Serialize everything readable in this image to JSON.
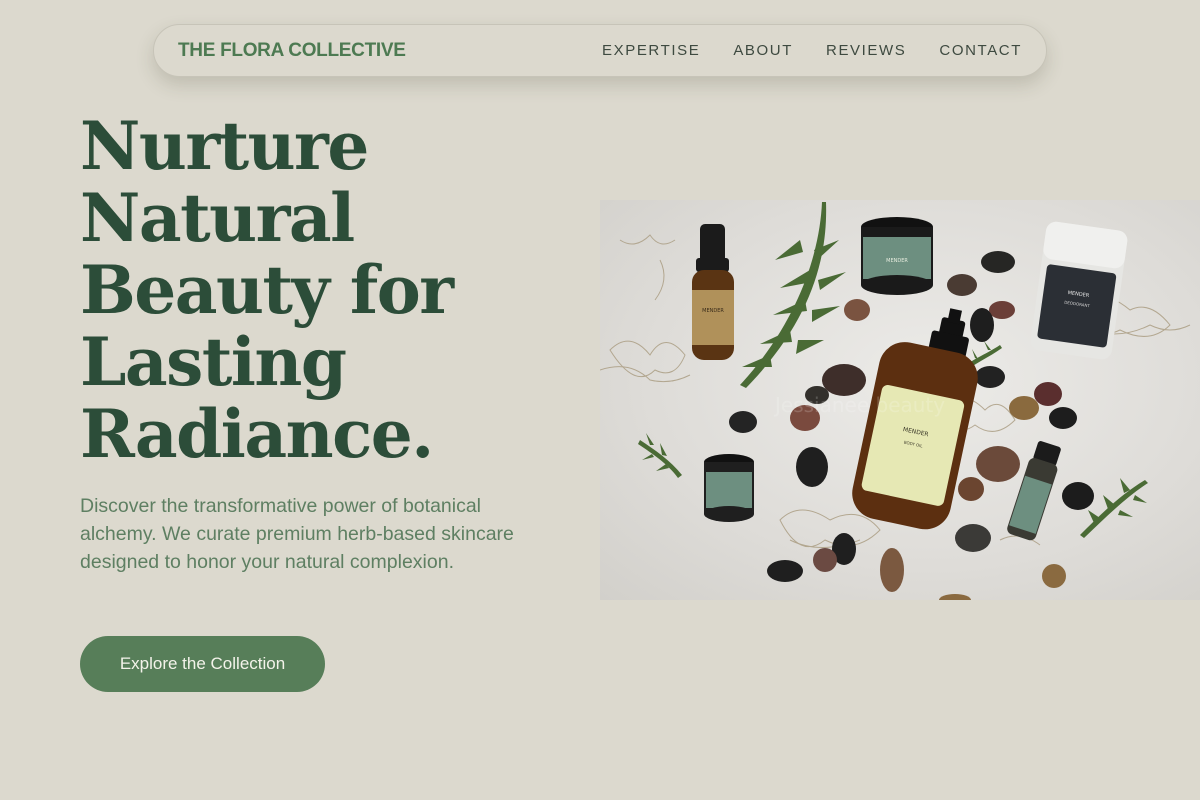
{
  "nav": {
    "brand": "THE FLORA COLLECTIVE",
    "links": [
      "EXPERTISE",
      "ABOUT",
      "REVIEWS",
      "CONTACT"
    ]
  },
  "hero": {
    "title": "Nurture Natural Beauty for Lasting Radiance.",
    "description": "Discover the transformative power of botanical alchemy. We curate premium herb-based skincare designed to honor your natural complexion.",
    "cta_label": "Explore the Collection"
  },
  "product_image": {
    "subject": "botanical skincare bottles and jars with stones and evergreen sprigs",
    "label_text": "MENDER"
  },
  "colors": {
    "background": "#dcd9ce",
    "brand_green": "#4d7a52",
    "title_green": "#2c4d39",
    "body_green": "#5e7f62",
    "button_green": "#577e59"
  }
}
